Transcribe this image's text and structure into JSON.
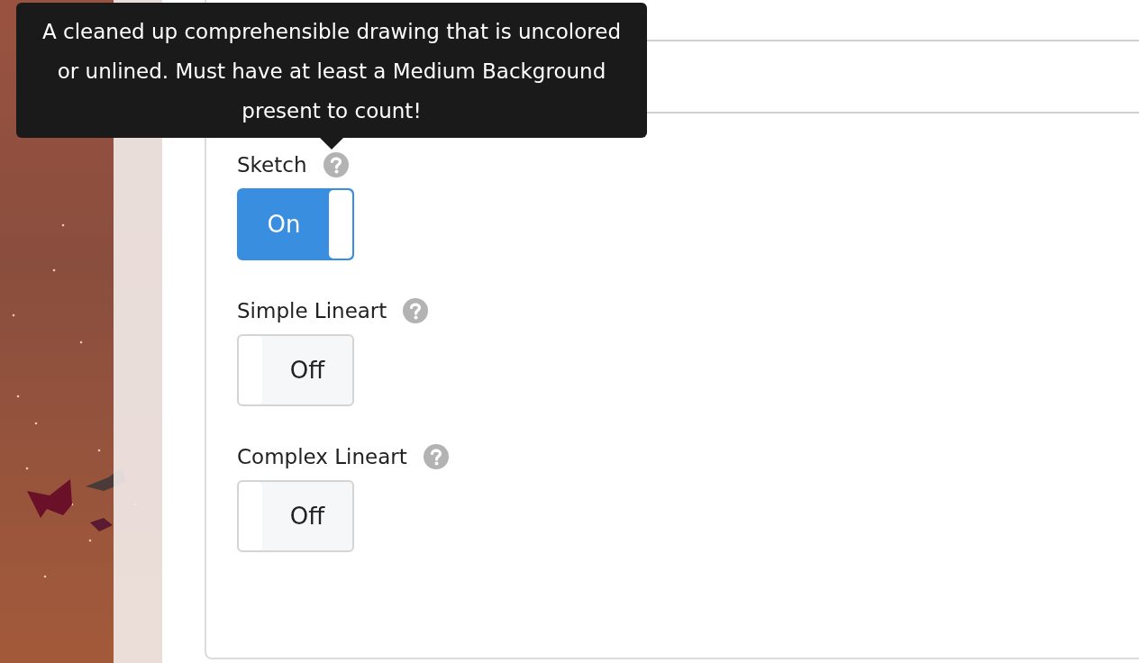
{
  "tooltip": {
    "text": "A cleaned up comprehensible drawing that is uncolored or unlined. Must have at least a Medium Background present to count!"
  },
  "toggles": [
    {
      "label": "Sketch",
      "on": true,
      "state_label": "On"
    },
    {
      "label": "Simple Lineart",
      "on": false,
      "state_label": "Off"
    },
    {
      "label": "Complex Lineart",
      "on": false,
      "state_label": "Off"
    }
  ]
}
